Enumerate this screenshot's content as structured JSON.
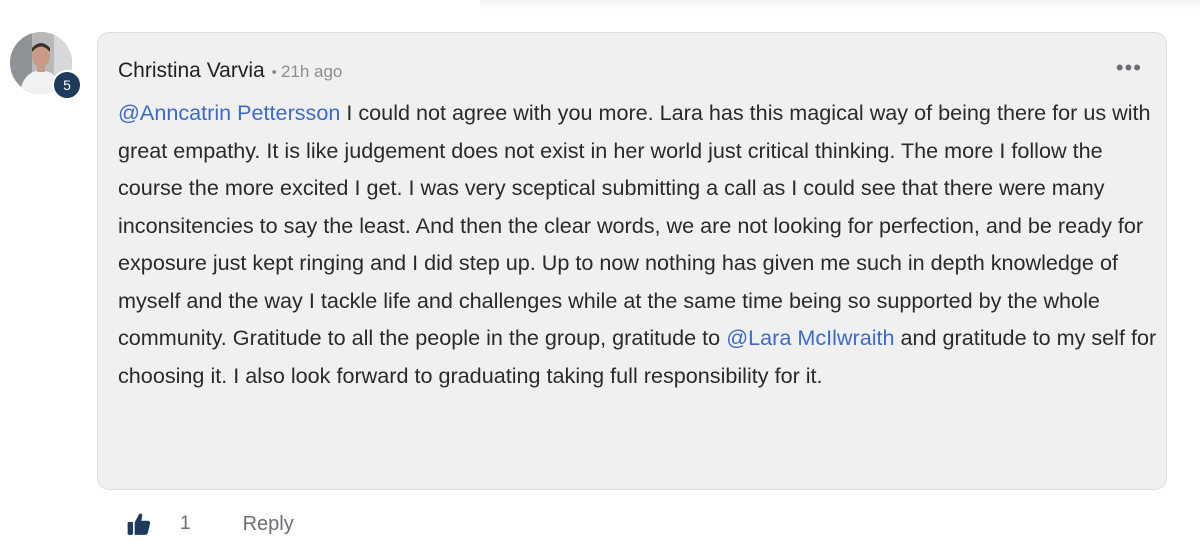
{
  "comment": {
    "author": "Christina Varvia",
    "separator": "•",
    "time": "21h ago",
    "level_badge": "5",
    "more_icon": "more-horizontal-icon",
    "more_label": "•••",
    "body": [
      {
        "type": "mention",
        "text": "@Anncatrin Pettersson"
      },
      {
        "type": "text",
        "text": " I could not agree with you more. Lara has this magical way of being there for us with great empathy. It is like judgement does not exist in her world just critical thinking. The more I follow the course the more excited I get. I was very sceptical submitting a call as I could see that there were many inconsitencies to say the least. And then the clear words, we are not looking for perfection, and be ready for exposure just kept ringing and I did step up. Up to now nothing has given me such in depth knowledge of myself and the way I tackle life and challenges while at the same time being so supported by the whole community. Gratitude to all the people in the group, gratitude to "
      },
      {
        "type": "mention",
        "text": "@Lara McIlwraith"
      },
      {
        "type": "text",
        "text": " and gratitude to my self for choosing it. I also look forward to graduating taking full responsibility for it."
      }
    ]
  },
  "actions": {
    "like_icon": "thumbs-up-icon",
    "like_count": "1",
    "reply_label": "Reply"
  },
  "colors": {
    "mention": "#3d6ac9",
    "like_icon": "#1e3a5c",
    "badge": "#1e3a5c",
    "bubble": "#f0f0f1"
  }
}
